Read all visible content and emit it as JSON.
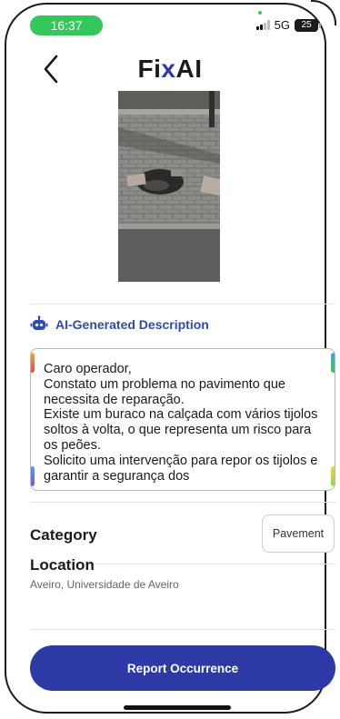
{
  "status_bar": {
    "time": "16:37",
    "network": "5G",
    "battery": "25"
  },
  "header": {
    "logo_prefix": "Fi",
    "logo_accent": "x",
    "logo_suffix": "AI",
    "back_icon": "chevron-left-icon"
  },
  "photo": {
    "subject": "damaged pavement with loose bricks"
  },
  "ai_section": {
    "icon": "robot-icon",
    "title": "AI-Generated Description",
    "description": "Caro operador,\nConstato um problema no pavimento que necessita de reparação.\nExiste um buraco na calçada com vários tijolos soltos à volta, o que representa um risco para os peões.\nSolicito uma intervenção para repor os tijolos e garantir a segurança dos"
  },
  "category": {
    "label": "Category",
    "value": "Pavement"
  },
  "location": {
    "label": "Location",
    "value": "Aveiro, Universidade de Aveiro"
  },
  "actions": {
    "report_label": "Report Occurrence"
  },
  "colors": {
    "accent": "#2d3aa5",
    "status_green": "#34c759",
    "link_blue": "#3249b2"
  }
}
